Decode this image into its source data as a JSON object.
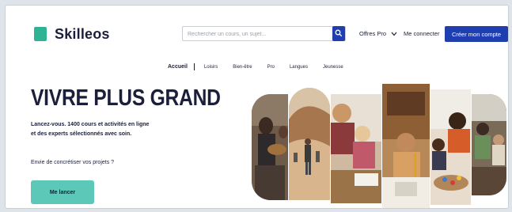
{
  "header": {
    "logo_text": "Skilleos",
    "search_placeholder": "Rechercher un cours, un sujet...",
    "offres_label": "Offres Pro",
    "connect_label": "Me connecter",
    "cta_label": "Créer mon compte"
  },
  "nav": {
    "items": [
      "Accueil",
      "Loisirs",
      "Bien-être",
      "Pro",
      "Langues",
      "Jeunesse"
    ]
  },
  "hero": {
    "title": "VIVRE PLUS GRAND",
    "subtitle_line1": "Lancez-vous. 1400 cours et activités en ligne",
    "subtitle_line2": "et des experts sélectionnés avec soin.",
    "prompt": "Envie de concrétiser vos projets ?",
    "cta_label": "Me lancer"
  },
  "colors": {
    "brand_navy": "#1b1f3b",
    "brand_blue": "#1f3fb0",
    "brand_teal": "#2fb394",
    "cta_teal": "#5cc8b8"
  },
  "icons": [
    "search-icon",
    "chevron-down-icon"
  ]
}
